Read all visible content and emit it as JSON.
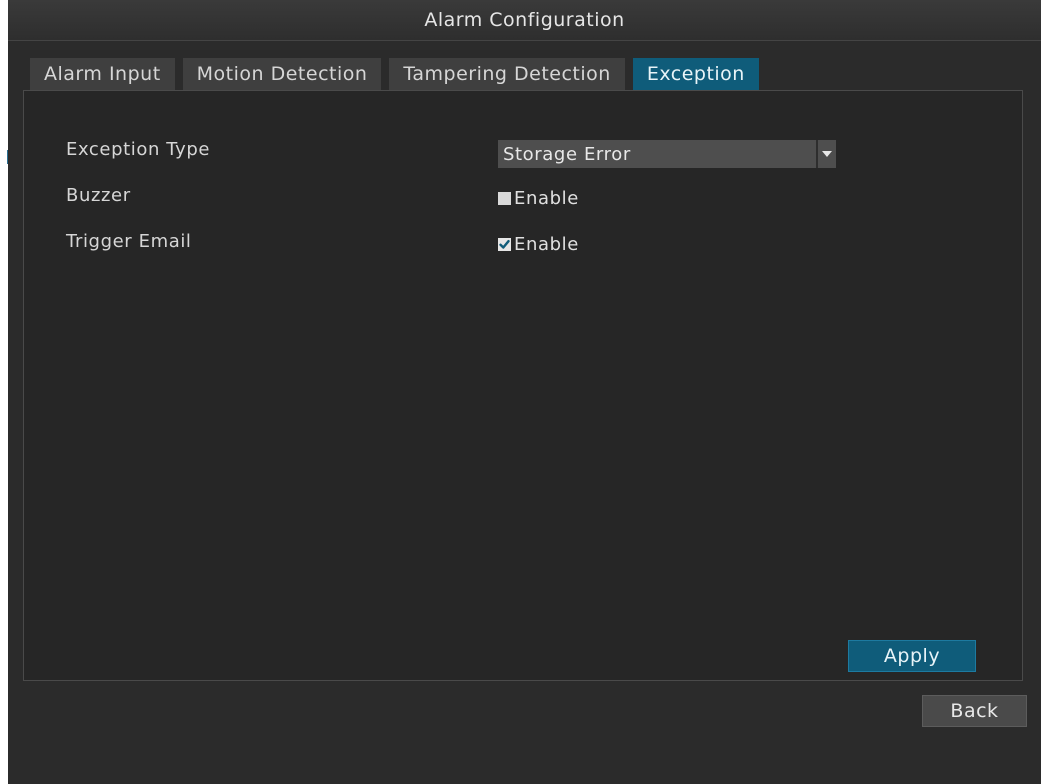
{
  "window": {
    "title": "Alarm Configuration"
  },
  "tabs": [
    {
      "label": "Alarm Input",
      "active": false
    },
    {
      "label": "Motion Detection",
      "active": false
    },
    {
      "label": "Tampering Detection",
      "active": false
    },
    {
      "label": "Exception",
      "active": true
    }
  ],
  "form": {
    "exception_type": {
      "label": "Exception Type",
      "value": "Storage Error"
    },
    "buzzer": {
      "label": "Buzzer",
      "option_label": "Enable",
      "checked": false
    },
    "trigger_email": {
      "label": "Trigger Email",
      "option_label": "Enable",
      "checked": true
    }
  },
  "buttons": {
    "apply_label": "Apply",
    "back_label": "Back"
  },
  "colors": {
    "accent": "#0f5c7a",
    "background": "#2b2b2b",
    "panel": "#262626"
  }
}
